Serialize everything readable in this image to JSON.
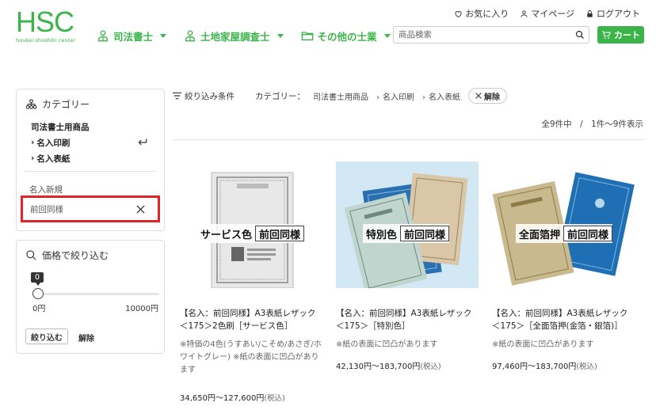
{
  "logo": {
    "main": "HSC",
    "sub": "houkei shoshiki center"
  },
  "util": {
    "favorites": "お気に入り",
    "mypage": "マイページ",
    "logout": "ログアウト"
  },
  "nav": [
    {
      "label": "司法書士"
    },
    {
      "label": "土地家屋調査士"
    },
    {
      "label": "その他の士業"
    }
  ],
  "search": {
    "placeholder": "商品検索"
  },
  "cart": {
    "label": "カート"
  },
  "category_box": {
    "title": "カテゴリー",
    "items": [
      "司法書士用商品",
      "名入印刷",
      "名入表紙"
    ],
    "new_label": "名入新規",
    "selected": "前回同様"
  },
  "price_box": {
    "title": "価格で絞り込む",
    "tooltip": "0",
    "min": "0円",
    "max": "10000円",
    "apply": "絞り込む",
    "clear": "解除",
    "level_fraction": 0
  },
  "filter": {
    "label": "絞り込み条件",
    "cat_label": "カテゴリー：",
    "crumbs": [
      "司法書士用商品",
      "名入印刷",
      "名入表紙"
    ],
    "remove": "解除"
  },
  "count": "全9件中　/　1件～9件表示",
  "products": [
    {
      "badge_label": "サービス色",
      "badge_box": "前回同様",
      "name": "【名入：前回同様】A3表紙レザック＜175＞2色刷［サービス色］",
      "note": "※特価の4色(うすあい/こそめ/あさぎ/ホワイトグレー) ※紙の表面に凹凸があります",
      "price": "34,650円～127,600円",
      "tax": "(税込)"
    },
    {
      "badge_label": "特別色",
      "badge_box": "前回同様",
      "name": "【名入：前回同様】A3表紙レザック＜175＞［特別色］",
      "note": "※紙の表面に凹凸があります",
      "price": "42,130円～183,700円",
      "tax": "(税込)"
    },
    {
      "badge_label": "全面箔押",
      "badge_box": "前回同様",
      "name": "【名入：前回同様】A3表紙レザック＜175＞［全面箔押(金箔・銀箔)］",
      "note": "※紙の表面に凹凸があります",
      "price": "97,460円～183,700円",
      "tax": "(税込)"
    }
  ],
  "colors": {
    "brand": "#3bb54a",
    "highlight": "#e0242a"
  }
}
